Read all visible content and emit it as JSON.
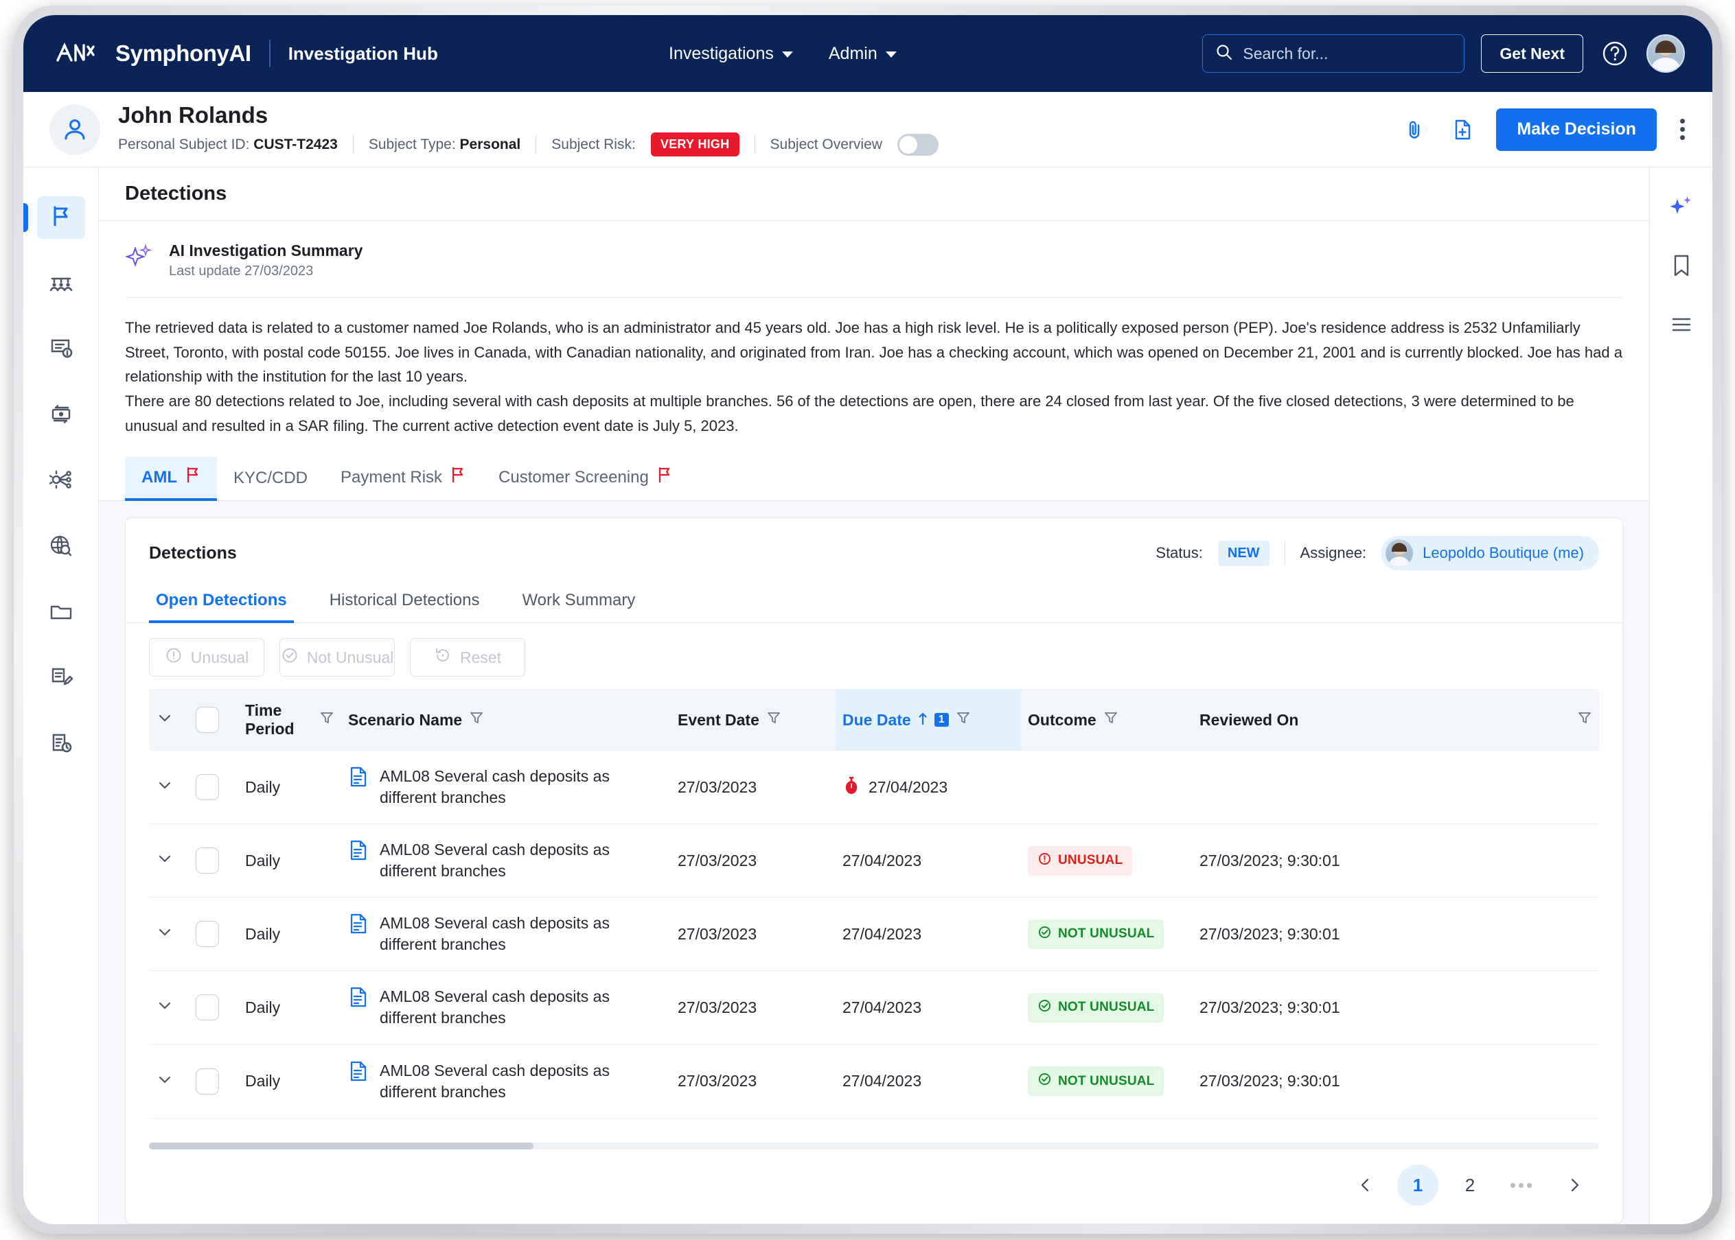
{
  "topnav": {
    "brand": "SymphonyAI",
    "app_name": "Investigation Hub",
    "nav_items": [
      {
        "label": "Investigations",
        "icon": "chevron-down-icon"
      },
      {
        "label": "Admin",
        "icon": "chevron-down-icon"
      }
    ],
    "search": {
      "placeholder": "Search for...",
      "value": "",
      "icon": "search-icon"
    },
    "get_next_label": "Get Next",
    "help_icon": "help-circle-icon",
    "avatar": "user-avatar"
  },
  "subject": {
    "name": "John Rolands",
    "id_label": "Personal Subject ID:",
    "id_value": "CUST-T2423",
    "type_label": "Subject Type:",
    "type_value": "Personal",
    "risk_label": "Subject Risk:",
    "risk_value": "VERY HIGH",
    "risk_color": "#e8192c",
    "overview_label": "Subject Overview",
    "overview_toggle_on": false,
    "actions": {
      "attach_icon": "paperclip-icon",
      "add_document_icon": "file-plus-icon",
      "make_decision_label": "Make Decision",
      "more_icon": "kebab-menu-icon"
    }
  },
  "leftrail": {
    "items": [
      {
        "name": "sidebar-item-detections",
        "icon": "flag-icon",
        "active": true
      },
      {
        "name": "sidebar-item-parties",
        "icon": "people-group-icon",
        "active": false
      },
      {
        "name": "sidebar-item-details",
        "icon": "document-info-icon",
        "active": false
      },
      {
        "name": "sidebar-item-transactions",
        "icon": "banknote-icon",
        "active": false
      },
      {
        "name": "sidebar-item-network",
        "icon": "network-nodes-icon",
        "active": false
      },
      {
        "name": "sidebar-item-research",
        "icon": "globe-search-icon",
        "active": false
      },
      {
        "name": "sidebar-item-files",
        "icon": "folder-icon",
        "active": false
      },
      {
        "name": "sidebar-item-notes",
        "icon": "document-edit-icon",
        "active": false
      },
      {
        "name": "sidebar-item-history",
        "icon": "clipboard-clock-icon",
        "active": false
      }
    ]
  },
  "rightrail": {
    "items": [
      {
        "name": "ai-assistant-button",
        "icon": "sparkle-icon"
      },
      {
        "name": "bookmarks-button",
        "icon": "bookmark-icon"
      },
      {
        "name": "activity-list-button",
        "icon": "list-icon"
      }
    ]
  },
  "page": {
    "title": "Detections"
  },
  "ai_summary": {
    "icon": "sparkle-icon",
    "title": "AI Investigation Summary",
    "last_update": "Last update 27/03/2023",
    "paragraphs": [
      "The retrieved data is related to a customer named Joe Rolands, who is an administrator and 45 years old.  Joe has a high risk level. He is a politically exposed person (PEP). Joe's residence address is 2532 Unfamiliarly Street, Toronto, with postal code 50155. Joe lives in Canada, with  Canadian nationality, and originated from Iran.  Joe has a checking account, which was opened on December 21, 2001 and is currently blocked. Joe has had a relationship with the institution for the last 10 years.",
      "There are 80 detections related to Joe, including several with cash deposits at multiple branches. 56 of the detections are open, there are 24 closed from last year. Of the five closed detections, 3 were determined to be unusual and resulted in a SAR filing.  The current active detection event date is July 5, 2023."
    ]
  },
  "category_tabs": [
    {
      "label": "AML",
      "flag": true,
      "active": true
    },
    {
      "label": "KYC/CDD",
      "flag": false,
      "active": false
    },
    {
      "label": "Payment Risk",
      "flag": true,
      "active": false
    },
    {
      "label": "Customer Screening",
      "flag": true,
      "active": false
    }
  ],
  "detections_panel": {
    "title": "Detections",
    "status_label": "Status:",
    "status_value": "NEW",
    "assignee_label": "Assignee:",
    "assignee_name": "Leopoldo Boutique (me)",
    "sub_tabs": [
      {
        "label": "Open Detections",
        "active": true
      },
      {
        "label": "Historical Detections",
        "active": false
      },
      {
        "label": "Work Summary",
        "active": false
      }
    ],
    "action_buttons": [
      {
        "label": "Unusual",
        "icon": "alert-circle-icon",
        "disabled": true
      },
      {
        "label": "Not Unusual",
        "icon": "check-circle-icon",
        "disabled": true
      },
      {
        "label": "Reset",
        "icon": "reset-icon",
        "disabled": true
      }
    ],
    "table": {
      "columns": [
        {
          "label": "",
          "name": "expand-all-column",
          "filter": false
        },
        {
          "label": "",
          "name": "select-all-column",
          "filter": false
        },
        {
          "label": "Time Period",
          "name": "time-period-column",
          "filter": true,
          "sorted": false
        },
        {
          "label": "Scenario Name",
          "name": "scenario-name-column",
          "filter": true,
          "sorted": false
        },
        {
          "label": "Event Date",
          "name": "event-date-column",
          "filter": true,
          "sorted": false
        },
        {
          "label": "Due Date",
          "name": "due-date-column",
          "filter": true,
          "sorted": true,
          "sort_dir": "asc",
          "sort_order": "1"
        },
        {
          "label": "Outcome",
          "name": "outcome-column",
          "filter": true,
          "sorted": false
        },
        {
          "label": "Reviewed On",
          "name": "reviewed-on-column",
          "filter": true,
          "sorted": false
        }
      ],
      "rows": [
        {
          "time_period": "Daily",
          "scenario": "AML08 Several cash deposits as different branches",
          "event_date": "27/03/2023",
          "due_date": "27/04/2023",
          "due_overdue": true,
          "outcome": "",
          "outcome_kind": "none",
          "reviewed_on": ""
        },
        {
          "time_period": "Daily",
          "scenario": "AML08 Several cash deposits as different branches",
          "event_date": "27/03/2023",
          "due_date": "27/04/2023",
          "due_overdue": false,
          "outcome": "UNUSUAL",
          "outcome_kind": "unusual",
          "reviewed_on": "27/03/2023; 9:30:01"
        },
        {
          "time_period": "Daily",
          "scenario": "AML08 Several cash deposits as different branches",
          "event_date": "27/03/2023",
          "due_date": "27/04/2023",
          "due_overdue": false,
          "outcome": "NOT UNUSUAL",
          "outcome_kind": "not-unusual",
          "reviewed_on": "27/03/2023; 9:30:01"
        },
        {
          "time_period": "Daily",
          "scenario": "AML08 Several cash deposits as different branches",
          "event_date": "27/03/2023",
          "due_date": "27/04/2023",
          "due_overdue": false,
          "outcome": "NOT UNUSUAL",
          "outcome_kind": "not-unusual",
          "reviewed_on": "27/03/2023; 9:30:01"
        },
        {
          "time_period": "Daily",
          "scenario": "AML08 Several cash deposits as different branches",
          "event_date": "27/03/2023",
          "due_date": "27/04/2023",
          "due_overdue": false,
          "outcome": "NOT UNUSUAL",
          "outcome_kind": "not-unusual",
          "reviewed_on": "27/03/2023; 9:30:01"
        }
      ]
    },
    "pagination": {
      "prev_icon": "chevron-left-icon",
      "next_icon": "chevron-right-icon",
      "pages": [
        "1",
        "2",
        "•••"
      ],
      "current": "1"
    }
  },
  "colors": {
    "brand_navy": "#0a2458",
    "accent_blue": "#1371f0",
    "risk_red": "#e8192c",
    "ok_green": "#148a2b"
  }
}
